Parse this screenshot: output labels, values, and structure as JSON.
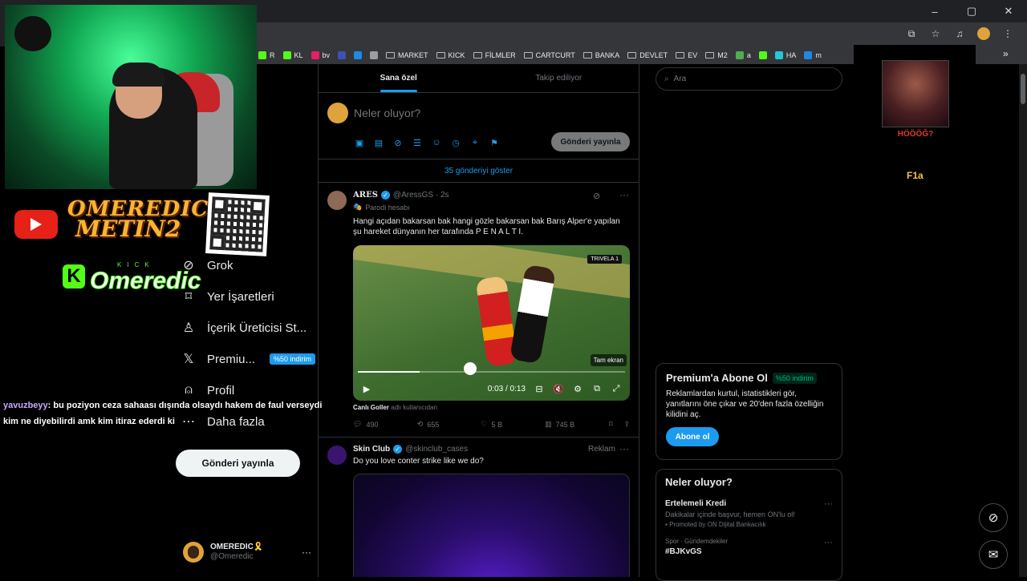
{
  "browser": {
    "window_controls": [
      "–",
      "▢",
      "✕"
    ],
    "bookmarks": [
      {
        "label": "R",
        "color": "#53fc18",
        "type": "site"
      },
      {
        "label": "KL",
        "color": "#53fc18",
        "type": "site"
      },
      {
        "label": "bv",
        "color": "#e91e63",
        "type": "site"
      },
      {
        "label": "",
        "color": "#3f51b5",
        "type": "site"
      },
      {
        "label": "",
        "color": "#1e88e5",
        "type": "site"
      },
      {
        "label": "",
        "color": "#9e9e9e",
        "type": "site"
      },
      {
        "label": "MARKET",
        "type": "folder"
      },
      {
        "label": "KICK",
        "type": "folder"
      },
      {
        "label": "FİLMLER",
        "type": "folder"
      },
      {
        "label": "CARTCURT",
        "type": "folder"
      },
      {
        "label": "BANKA",
        "type": "folder"
      },
      {
        "label": "DEVLET",
        "type": "folder"
      },
      {
        "label": "EV",
        "type": "folder"
      },
      {
        "label": "M2",
        "type": "folder"
      },
      {
        "label": "a",
        "color": "#4caf50",
        "type": "site"
      },
      {
        "label": "",
        "color": "#53fc18",
        "type": "site"
      },
      {
        "label": "HA",
        "color": "#26c6da",
        "type": "site"
      },
      {
        "label": "m",
        "color": "#1e88e5",
        "type": "site"
      }
    ],
    "more_bookmarks": "»"
  },
  "stream_overlay": {
    "brand_line1": "OMEREDIC",
    "brand_line2": "METIN2",
    "kick_label": "KICK",
    "kick_name": "Omeredic",
    "kick_logo": "K",
    "chat": {
      "user": "yavuzbeyy",
      "message": ": bu poziyon ceza sahaası dışında olsaydı hakem de faul verseydi kim ne diyebilirdi amk kim itiraz ederdi ki"
    },
    "champion_caption": "HÖÖÖĞ?",
    "f1a_label": "F1a"
  },
  "sidebar": {
    "items": [
      {
        "label": "Grok",
        "icon": "grok-icon",
        "glyph": "⊘"
      },
      {
        "label": "Yer İşaretleri",
        "icon": "bookmark-icon",
        "glyph": "⌑"
      },
      {
        "label": "İçerik Üreticisi St...",
        "icon": "creator-studio-icon",
        "glyph": "♙"
      },
      {
        "label": "Premiu...",
        "icon": "x-logo-icon",
        "glyph": "𝕏",
        "badge": "%50 indirim"
      },
      {
        "label": "Profil",
        "icon": "profile-icon",
        "glyph": "⍝"
      },
      {
        "label": "Daha fazla",
        "icon": "more-circle-icon",
        "glyph": "⋯"
      }
    ],
    "post_button": "Gönderi yayınla",
    "profile": {
      "name": "OMEREDIC🎗️",
      "handle": "@Omeredic",
      "more": "···"
    }
  },
  "timeline": {
    "tabs": [
      {
        "label": "Sana özel",
        "active": true
      },
      {
        "label": "Takip ediliyor",
        "active": false
      }
    ],
    "compose": {
      "placeholder": "Neler oluyor?",
      "post_button": "Gönderi yayınla"
    },
    "show_more": "35 gönderiyi göster",
    "tweets": [
      {
        "name": "ARES",
        "handle": "@AressGS · 2s",
        "label": "Parodi hesabı",
        "text": "Hangi açıdan bakarsan bak hangi gözle bakarsan bak Barış Alper'e yapılan şu hareket dünyanın her tarafında P E N A L T I.",
        "video": {
          "time": "0:03 / 0:13",
          "progress": 0.23,
          "fullscreen_label": "Tam ekran",
          "overlay_tag": "TRIVELA 1"
        },
        "source_name": "Canlı Goller",
        "source_suffix": "adlı kullanıcıdan",
        "replies": "490",
        "reposts": "655",
        "likes": "5 B",
        "views": "745 B"
      },
      {
        "name": "Skin Club",
        "handle": "@skinclub_cases",
        "ad_label": "Reklam",
        "text": "Do you love conter strike like we do?"
      }
    ]
  },
  "right_column": {
    "search_placeholder": "Ara",
    "premium": {
      "title": "Premium'a Abone Ol",
      "badge": "%50 indirim",
      "desc": "Reklamlardan kurtul, istatistikleri gör, yanıtlarını öne çıkar ve 20'den fazla özelliğin kilidini aç.",
      "button": "Abone ol"
    },
    "trends": {
      "title": "Neler oluyor?",
      "items": [
        {
          "label": "Ertelemeli Kredi",
          "sub": "Dakikalar içinde başvur, hemen ON'lu ol!",
          "promo": "Promoted by ON Dijital Bankacılık"
        },
        {
          "category": "Spor · Gündemdekiler",
          "label": "#BJKvGS"
        }
      ]
    }
  },
  "colors": {
    "accent": "#1d9bf0",
    "kick_green": "#53fc18",
    "background": "#000000",
    "border": "#2f3336"
  }
}
